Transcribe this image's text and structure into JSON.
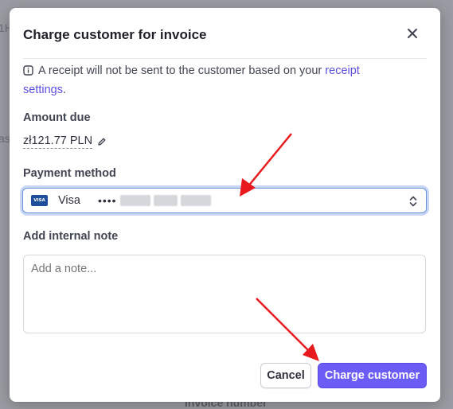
{
  "background": {
    "left_fragment_1": "1H",
    "left_fragment_2": "as",
    "bottom_text": "Invoice number"
  },
  "dialog": {
    "title": "Charge customer for invoice",
    "notice_text": "A receipt will not be sent to the customer based on your ",
    "notice_link": "receipt settings",
    "notice_end": ".",
    "amount_label": "Amount due",
    "amount_value": "zł121.77 PLN",
    "payment_label": "Payment method",
    "payment": {
      "brand": "Visa",
      "masked_prefix": "••••"
    },
    "note_label": "Add internal note",
    "note_placeholder": "Add a note...",
    "note_value": "",
    "cancel_label": "Cancel",
    "charge_label": "Charge customer"
  },
  "colors": {
    "accent": "#6b5cf5",
    "link": "#5b4fe0",
    "annotation_arrow": "#e8191c"
  },
  "icons": {
    "close": "close-icon",
    "info": "info-icon",
    "edit": "pencil-icon",
    "card": "visa-card-icon",
    "select": "chevron-up-down-icon"
  }
}
